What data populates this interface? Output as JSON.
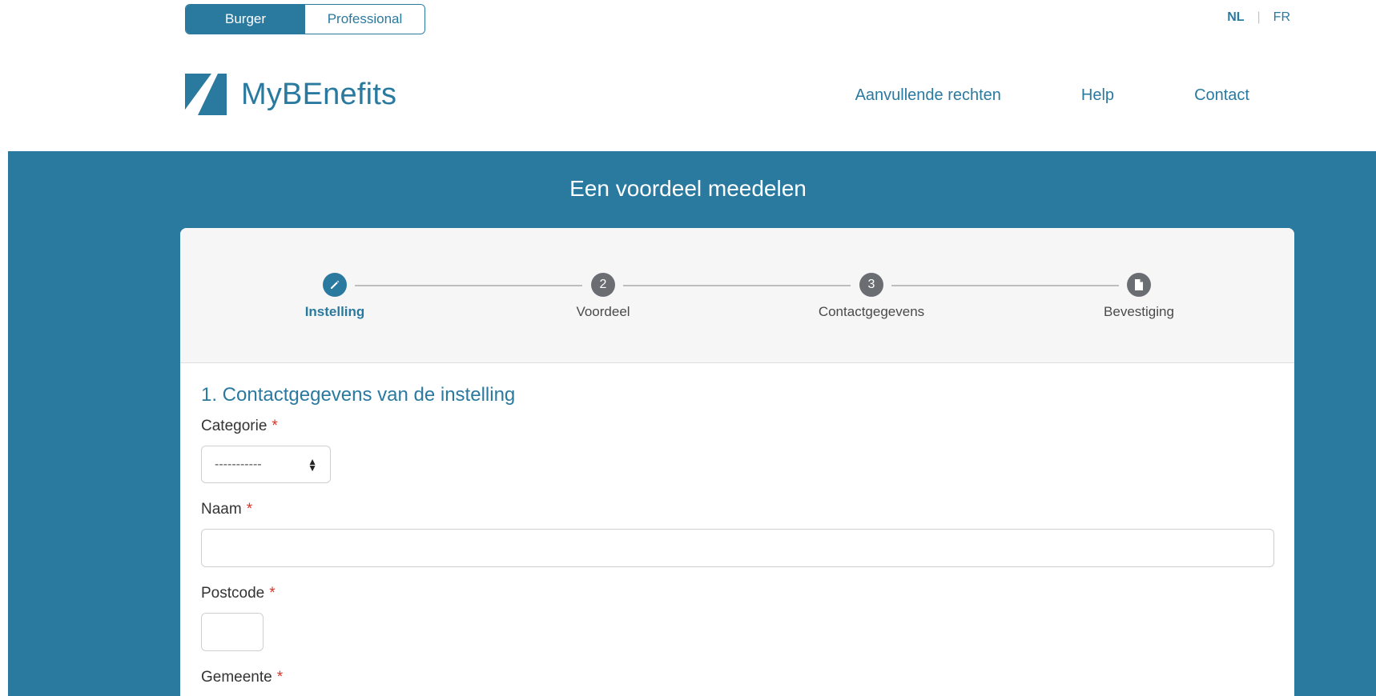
{
  "audience_toggle": {
    "burger": "Burger",
    "professional": "Professional",
    "selected": "Burger"
  },
  "language": {
    "nl": "NL",
    "fr": "FR",
    "active": "NL"
  },
  "logo": {
    "text": "MyBEnefits",
    "icon": "mybenefits-logo-icon"
  },
  "nav": {
    "items": [
      "Aanvullende rechten",
      "Help",
      "Contact"
    ]
  },
  "page_title": "Een voordeel meedelen",
  "stepper": {
    "steps": [
      {
        "label": "Instelling",
        "marker": "pencil-icon",
        "active": true
      },
      {
        "label": "Voordeel",
        "marker": "2",
        "active": false
      },
      {
        "label": "Contactgegevens",
        "marker": "3",
        "active": false
      },
      {
        "label": "Bevestiging",
        "marker": "document-icon",
        "active": false
      }
    ]
  },
  "form": {
    "section_title": "1. Contactgegevens van de instelling",
    "required_mark": "*",
    "categorie": {
      "label": "Categorie",
      "value": "-----------"
    },
    "naam": {
      "label": "Naam",
      "value": ""
    },
    "postcode": {
      "label": "Postcode",
      "value": ""
    },
    "gemeente": {
      "label": "Gemeente"
    }
  },
  "colors": {
    "primary": "#2a7aa0",
    "required": "#d9342b",
    "stepper_bg": "#f6f6f6",
    "inactive_step": "#6a6e73"
  }
}
